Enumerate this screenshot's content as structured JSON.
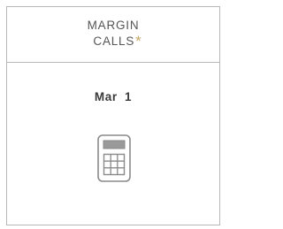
{
  "card": {
    "title_line1": "MARGIN",
    "title_line2": "CALLS",
    "title_marker": "*",
    "accent_color": "#c4a86a",
    "date": "Mar 1"
  },
  "icons": {
    "calculator": "calculator-icon"
  }
}
